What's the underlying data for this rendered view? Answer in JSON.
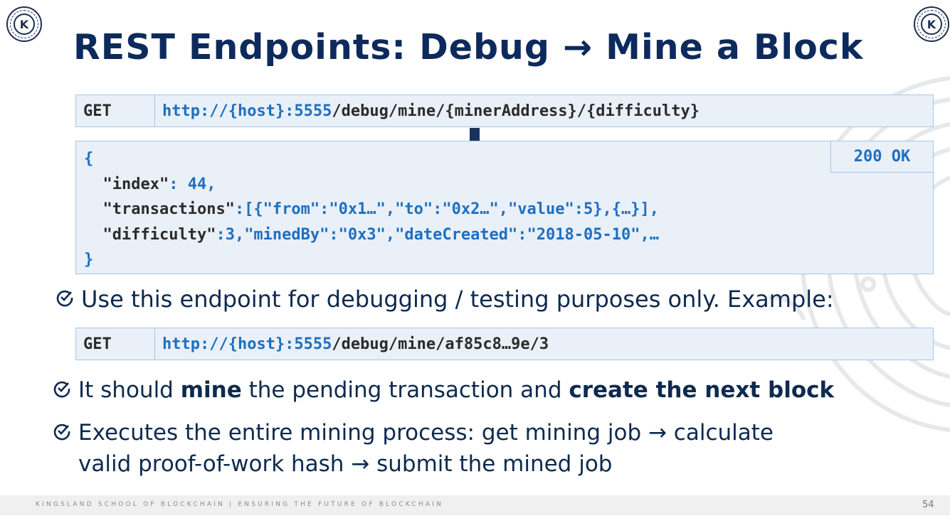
{
  "slide": {
    "title": "REST Endpoints: Debug → Mine a Block",
    "logo_letter": "K",
    "endpoint_1": {
      "method": "GET",
      "url_host": "http://{host}:5555",
      "url_path": "/debug/mine/{minerAddress}/{difficulty}"
    },
    "response": {
      "status": "200 OK",
      "open_brace": "{",
      "line1_key": "\"index\"",
      "line1_rest": ": 44,",
      "line2_key": "\"transactions\"",
      "line2_rest": ":[{\"from\":\"0x1…\",\"to\":\"0x2…\",\"value\":5},{…}],",
      "line3_key": "\"difficulty\"",
      "line3_rest": ":3,\"minedBy\":\"0x3\",\"dateCreated\":\"2018-05-10\",…",
      "close_brace": "}"
    },
    "bullet_1": "Use this endpoint for debugging / testing purposes only. Example:",
    "endpoint_2": {
      "method": "GET",
      "url_host": "http://{host}:5555",
      "url_path": "/debug/mine/af85c8…9e/3"
    },
    "bullet_2": {
      "part1": "It should ",
      "bold1": "mine",
      "part2": " the pending transaction and ",
      "bold2": "create the next block"
    },
    "bullet_3": {
      "line1": "Executes the entire mining process: get mining job → calculate",
      "line2": "valid proof-of-work hash → submit the mined job"
    },
    "footer": "KINGSLAND SCHOOL OF BLOCKCHAIN | ENSURING THE FUTURE OF BLOCKCHAIN",
    "page_number": "54"
  },
  "colors": {
    "title": "#0d2a5c",
    "code_blue": "#1f6fc0",
    "box_fill": "#e9f0f8",
    "box_border": "#a9c5e6"
  },
  "icons": [
    "logo-icon",
    "down-arrow-icon",
    "check-icon",
    "circuit-watermark"
  ]
}
